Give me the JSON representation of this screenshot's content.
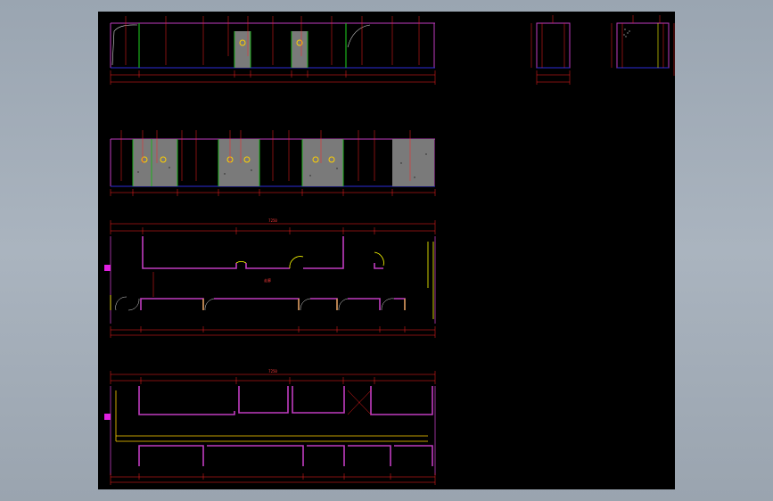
{
  "colors": {
    "background": "#000000",
    "wall": "#c03cc0",
    "dimension": "#ff2020",
    "panel": "#7a7a7a",
    "trim": "#1cb01c",
    "floor_line": "#2b2bd8",
    "door_jamb": "#ffff00",
    "marker": "#e020e0"
  },
  "drawing": {
    "plan1_total_dim": "7250",
    "plan1_room_label": "走廊",
    "plan2_total_dim": "7250"
  }
}
